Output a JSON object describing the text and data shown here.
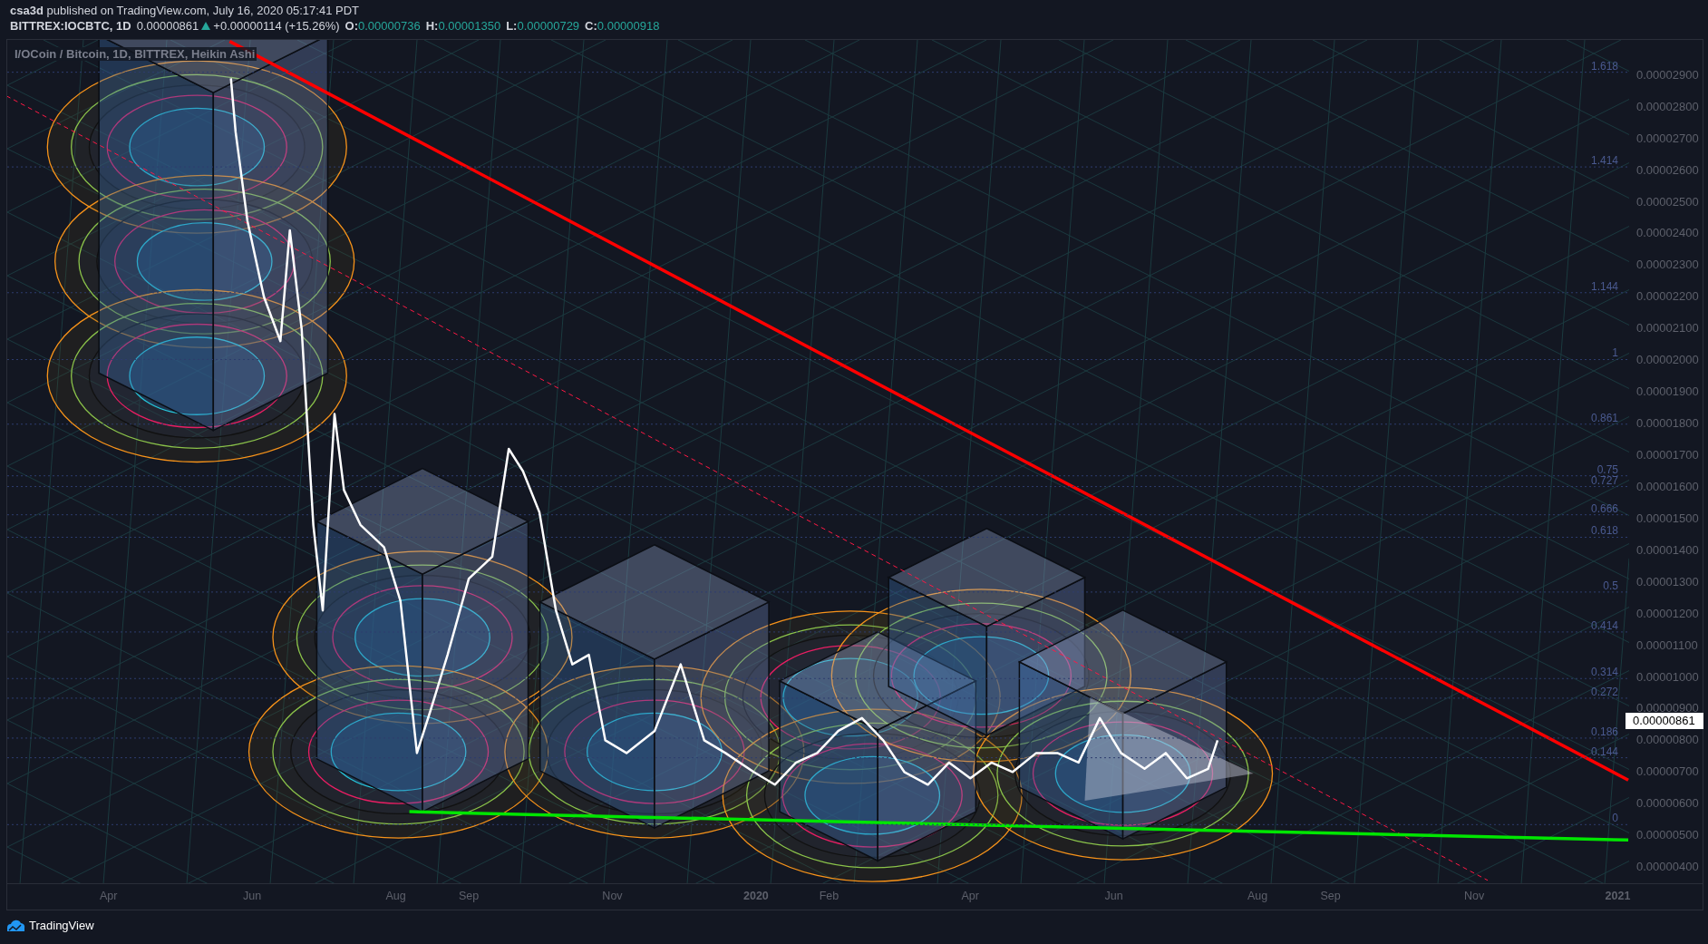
{
  "header": {
    "byline": "**csa3d** published on TradingView.com, July 16, 2020 05:17:41 PDT",
    "symbol": "BITTREX:IOCBTC, 1D",
    "price": "0.00000861",
    "change": "+0.00000114 (+15.26%)",
    "ohlc": [
      {
        "label": "O:",
        "value": "0.00000736"
      },
      {
        "label": "H:",
        "value": "0.00001350"
      },
      {
        "label": "L:",
        "value": "0.00000729"
      },
      {
        "label": "C:",
        "value": "0.00000918"
      }
    ]
  },
  "chart": {
    "legend": "I/OCoin / Bitcoin, 1D, BITTREX, Heikin Ashi",
    "chart_data": {
      "type": "line",
      "grid": true,
      "x": [
        "2019-05-23",
        "2019-05-25",
        "2019-05-30",
        "2019-06-06",
        "2019-06-13",
        "2019-06-17",
        "2019-06-22",
        "2019-06-27",
        "2019-07-01",
        "2019-07-06",
        "2019-07-10",
        "2019-07-17",
        "2019-07-27",
        "2019-08-03",
        "2019-08-10",
        "2019-08-16",
        "2019-08-23",
        "2019-09-01",
        "2019-09-11",
        "2019-09-18",
        "2019-09-24",
        "2019-10-01",
        "2019-10-08",
        "2019-10-15",
        "2019-10-22",
        "2019-10-29",
        "2019-11-07",
        "2019-11-19",
        "2019-11-30",
        "2019-12-10",
        "2019-12-19",
        "2019-12-31",
        "2020-01-09",
        "2020-01-18",
        "2020-01-27",
        "2020-02-05",
        "2020-02-15",
        "2020-02-24",
        "2020-03-04",
        "2020-03-14",
        "2020-03-23",
        "2020-04-01",
        "2020-04-10",
        "2020-04-19",
        "2020-04-29",
        "2020-05-08",
        "2020-05-17",
        "2020-05-26",
        "2020-06-04",
        "2020-06-14",
        "2020-06-23",
        "2020-07-02",
        "2020-07-11",
        "2020-07-15"
      ],
      "values": [
        2.89e-05,
        2.72e-05,
        2.44e-05,
        2.2e-05,
        2.06e-05,
        2.41e-05,
        2.1e-05,
        1.48e-05,
        1.21e-05,
        1.83e-05,
        1.59e-05,
        1.48e-05,
        1.41e-05,
        1.24e-05,
        7.6e-06,
        9e-06,
        1.07e-05,
        1.31e-05,
        1.38e-05,
        1.72e-05,
        1.65e-05,
        1.52e-05,
        1.21e-05,
        1.04e-05,
        1.07e-05,
        8e-06,
        7.6e-06,
        8.3e-06,
        1.04e-05,
        8e-06,
        7.6e-06,
        7e-06,
        6.6e-06,
        7.3e-06,
        7.6e-06,
        8.3e-06,
        8.7e-06,
        8e-06,
        7e-06,
        6.6e-06,
        7.3e-06,
        6.8e-06,
        7.3e-06,
        7e-06,
        7.6e-06,
        7.6e-06,
        7.3e-06,
        8.7e-06,
        7.6e-06,
        7.1e-06,
        7.6e-06,
        6.8e-06,
        7.1e-06,
        8e-06
      ],
      "xlim": [
        "2019-02-17",
        "2021-02-06"
      ],
      "ylim": [
        3.46e-06,
        3.011e-05
      ],
      "xticks": [
        {
          "value": "2019-04-01",
          "label": "Apr"
        },
        {
          "value": "2019-06-01",
          "label": "Jun"
        },
        {
          "value": "2019-08-01",
          "label": "Aug"
        },
        {
          "value": "2019-09-01",
          "label": "Sep"
        },
        {
          "value": "2019-11-01",
          "label": "Nov"
        },
        {
          "value": "2020-01-01",
          "label": "2020"
        },
        {
          "value": "2020-02-01",
          "label": "Feb"
        },
        {
          "value": "2020-04-01",
          "label": "Apr"
        },
        {
          "value": "2020-06-01",
          "label": "Jun"
        },
        {
          "value": "2020-08-01",
          "label": "Aug"
        },
        {
          "value": "2020-09-01",
          "label": "Sep"
        },
        {
          "value": "2020-11-01",
          "label": "Nov"
        },
        {
          "value": "2021-01-01",
          "label": "2021"
        }
      ],
      "yticks": [
        {
          "value": 2.9e-05,
          "label": "0.00002900"
        },
        {
          "value": 2.8e-05,
          "label": "0.00002800"
        },
        {
          "value": 2.7e-05,
          "label": "0.00002700"
        },
        {
          "value": 2.6e-05,
          "label": "0.00002600"
        },
        {
          "value": 2.5e-05,
          "label": "0.00002500"
        },
        {
          "value": 2.4e-05,
          "label": "0.00002400"
        },
        {
          "value": 2.3e-05,
          "label": "0.00002300"
        },
        {
          "value": 2.2e-05,
          "label": "0.00002200"
        },
        {
          "value": 2.1e-05,
          "label": "0.00002100"
        },
        {
          "value": 2e-05,
          "label": "0.00002000"
        },
        {
          "value": 1.9e-05,
          "label": "0.00001900"
        },
        {
          "value": 1.8e-05,
          "label": "0.00001800"
        },
        {
          "value": 1.7e-05,
          "label": "0.00001700"
        },
        {
          "value": 1.6e-05,
          "label": "0.00001600"
        },
        {
          "value": 1.5e-05,
          "label": "0.00001500"
        },
        {
          "value": 1.4e-05,
          "label": "0.00001400"
        },
        {
          "value": 1.3e-05,
          "label": "0.00001300"
        },
        {
          "value": 1.2e-05,
          "label": "0.00001200"
        },
        {
          "value": 1.1e-05,
          "label": "0.00001100"
        },
        {
          "value": 1e-05,
          "label": "0.00001000"
        },
        {
          "value": 9e-06,
          "label": "0.00000900"
        },
        {
          "value": 8e-06,
          "label": "0.00000800"
        },
        {
          "value": 7e-06,
          "label": "0.00000700"
        },
        {
          "value": 6e-06,
          "label": "0.00000600"
        },
        {
          "value": 5e-06,
          "label": "0.00000500"
        },
        {
          "value": 4e-06,
          "label": "0.00000400"
        }
      ]
    },
    "fib_levels": [
      "1.618",
      "1.414",
      "1.144",
      "1",
      "0.861",
      "0.75",
      "0.727",
      "0.666",
      "0.618",
      "0.5",
      "0.414",
      "0.314",
      "0.272",
      "0.186",
      "0.144",
      "0"
    ],
    "last_price": "0.00000861"
  },
  "footer": {
    "brand": "TradingView"
  }
}
